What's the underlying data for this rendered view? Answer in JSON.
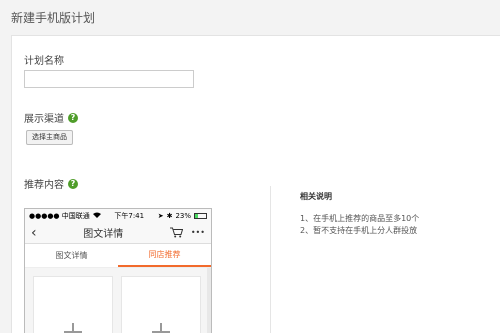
{
  "page": {
    "title": "新建手机版计划"
  },
  "form": {
    "plan_name_label": "计划名称",
    "plan_name_value": "",
    "channel_label": "展示渠道",
    "select_button": "选择主商品",
    "recommend_label": "推荐内容",
    "help_icon_glyph": "?"
  },
  "phone": {
    "carrier": "●●●●● 中国联通",
    "time": "下午7:41",
    "battery_text": "23%",
    "battery_level": 0.23,
    "title": "图文详情",
    "back_glyph": "‹",
    "more_glyph": "•••",
    "tabs": [
      {
        "label": "图文详情",
        "active": false
      },
      {
        "label": "同店推荐",
        "active": true
      }
    ]
  },
  "notes": {
    "title": "相关说明",
    "items": [
      "1、在手机上推荐的商品至多10个",
      "2、暂不支持在手机上分人群投放"
    ]
  },
  "colors": {
    "accent": "#f26a2c",
    "help": "#4f9d2a"
  }
}
